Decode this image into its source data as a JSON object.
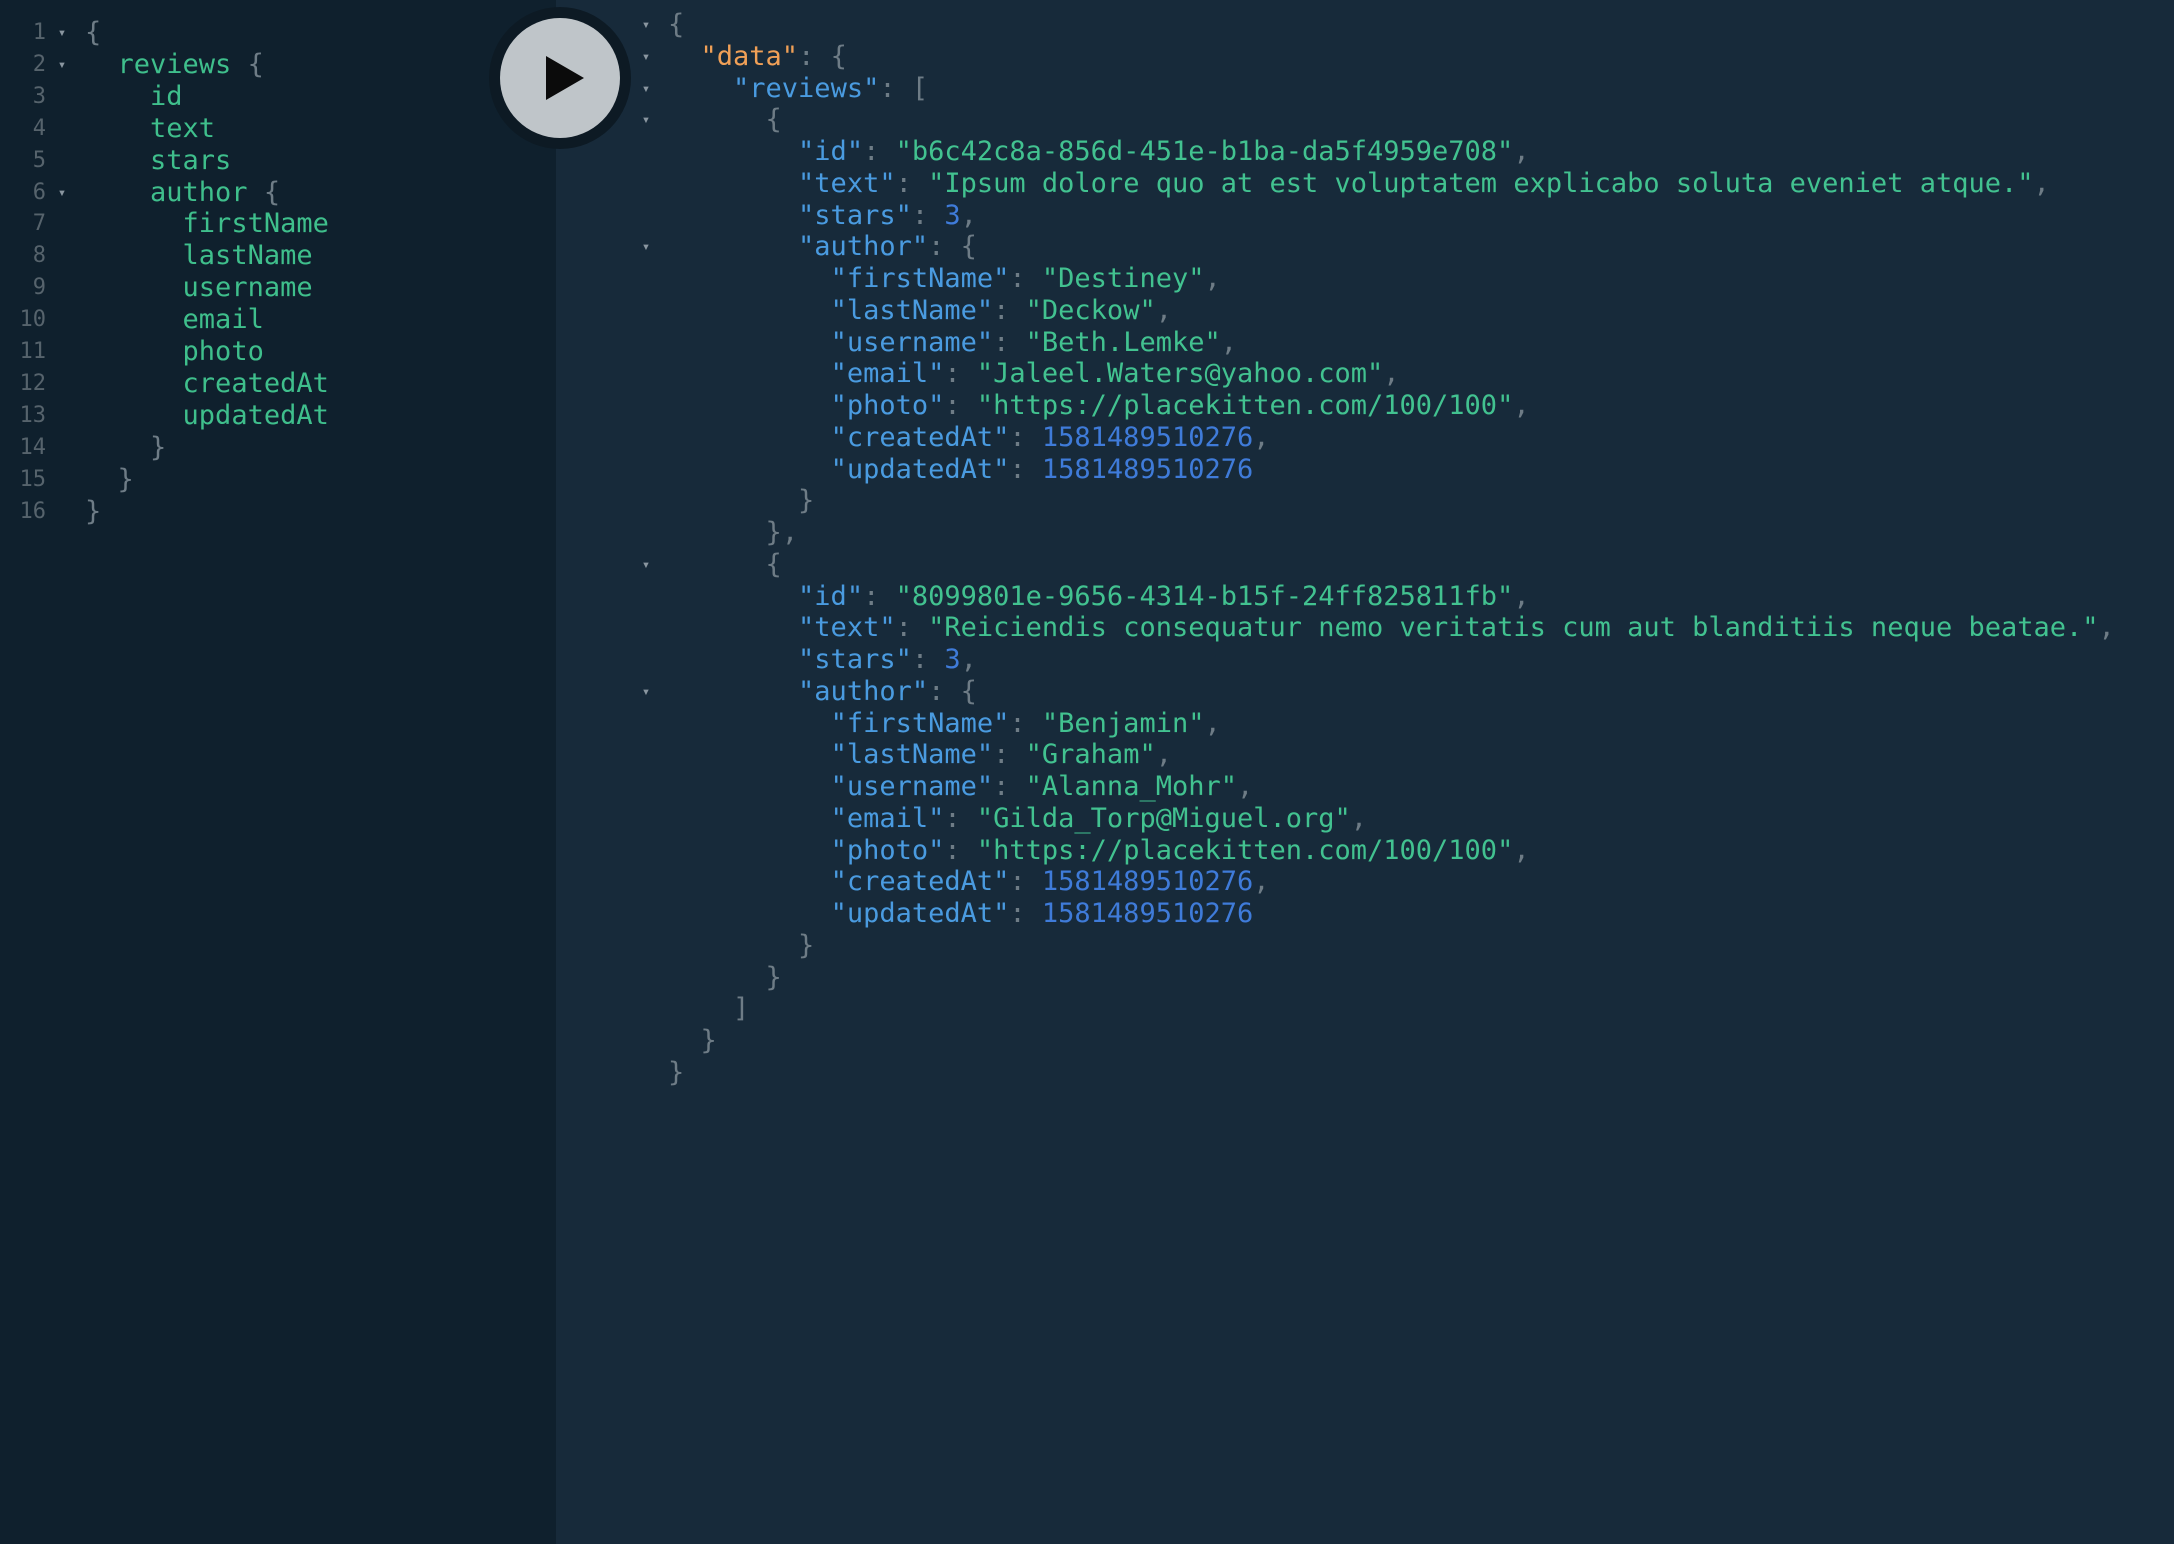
{
  "colors": {
    "editor_bg": "#0f202d",
    "result_bg": "#172a3a",
    "field": "#3fbf8c",
    "punctuation": "#6e7c86",
    "key": "#4a9be0",
    "data_key": "#f0a057",
    "string": "#42c290",
    "number": "#3f7bd9",
    "run_button": "#bfc5c9"
  },
  "icons": {
    "run": "play-icon",
    "fold": "fold-triangle-icon"
  },
  "fold_glyph": "▾",
  "query_lines": [
    {
      "num": "1",
      "text": "{",
      "fold": true
    },
    {
      "num": "2",
      "text": "  reviews {",
      "fold": true
    },
    {
      "num": "3",
      "text": "    id"
    },
    {
      "num": "4",
      "text": "    text"
    },
    {
      "num": "5",
      "text": "    stars"
    },
    {
      "num": "6",
      "text": "    author {",
      "fold": true
    },
    {
      "num": "7",
      "text": "      firstName"
    },
    {
      "num": "8",
      "text": "      lastName"
    },
    {
      "num": "9",
      "text": "      username"
    },
    {
      "num": "10",
      "text": "      email"
    },
    {
      "num": "11",
      "text": "      photo"
    },
    {
      "num": "12",
      "text": "      createdAt"
    },
    {
      "num": "13",
      "text": "      updatedAt"
    },
    {
      "num": "14",
      "text": "    }"
    },
    {
      "num": "15",
      "text": "  }"
    },
    {
      "num": "16",
      "text": "}"
    }
  ],
  "result_lines": [
    {
      "fold": true,
      "text": "{"
    },
    {
      "fold": true,
      "text": "  \"data\": {"
    },
    {
      "fold": true,
      "text": "    \"reviews\": ["
    },
    {
      "fold": true,
      "text": "      {"
    },
    {
      "fold": false,
      "text": "        \"id\": \"b6c42c8a-856d-451e-b1ba-da5f4959e708\","
    },
    {
      "fold": false,
      "text": "        \"text\": \"Ipsum dolore quo at est voluptatem explicabo soluta eveniet atque.\","
    },
    {
      "fold": false,
      "text": "        \"stars\": 3,"
    },
    {
      "fold": true,
      "text": "        \"author\": {"
    },
    {
      "fold": false,
      "text": "          \"firstName\": \"Destiney\","
    },
    {
      "fold": false,
      "text": "          \"lastName\": \"Deckow\","
    },
    {
      "fold": false,
      "text": "          \"username\": \"Beth.Lemke\","
    },
    {
      "fold": false,
      "text": "          \"email\": \"Jaleel.Waters@yahoo.com\","
    },
    {
      "fold": false,
      "text": "          \"photo\": \"https://placekitten.com/100/100\","
    },
    {
      "fold": false,
      "text": "          \"createdAt\": 1581489510276,"
    },
    {
      "fold": false,
      "text": "          \"updatedAt\": 1581489510276"
    },
    {
      "fold": false,
      "text": "        }"
    },
    {
      "fold": false,
      "text": "      },"
    },
    {
      "fold": true,
      "text": "      {"
    },
    {
      "fold": false,
      "text": "        \"id\": \"8099801e-9656-4314-b15f-24ff825811fb\","
    },
    {
      "fold": false,
      "text": "        \"text\": \"Reiciendis consequatur nemo veritatis cum aut blanditiis neque beatae.\","
    },
    {
      "fold": false,
      "text": "        \"stars\": 3,"
    },
    {
      "fold": true,
      "text": "        \"author\": {"
    },
    {
      "fold": false,
      "text": "          \"firstName\": \"Benjamin\","
    },
    {
      "fold": false,
      "text": "          \"lastName\": \"Graham\","
    },
    {
      "fold": false,
      "text": "          \"username\": \"Alanna_Mohr\","
    },
    {
      "fold": false,
      "text": "          \"email\": \"Gilda_Torp@Miguel.org\","
    },
    {
      "fold": false,
      "text": "          \"photo\": \"https://placekitten.com/100/100\","
    },
    {
      "fold": false,
      "text": "          \"createdAt\": 1581489510276,"
    },
    {
      "fold": false,
      "text": "          \"updatedAt\": 1581489510276"
    },
    {
      "fold": false,
      "text": "        }"
    },
    {
      "fold": false,
      "text": "      }"
    },
    {
      "fold": false,
      "text": "    ]"
    },
    {
      "fold": false,
      "text": "  }"
    },
    {
      "fold": false,
      "text": "}"
    }
  ]
}
